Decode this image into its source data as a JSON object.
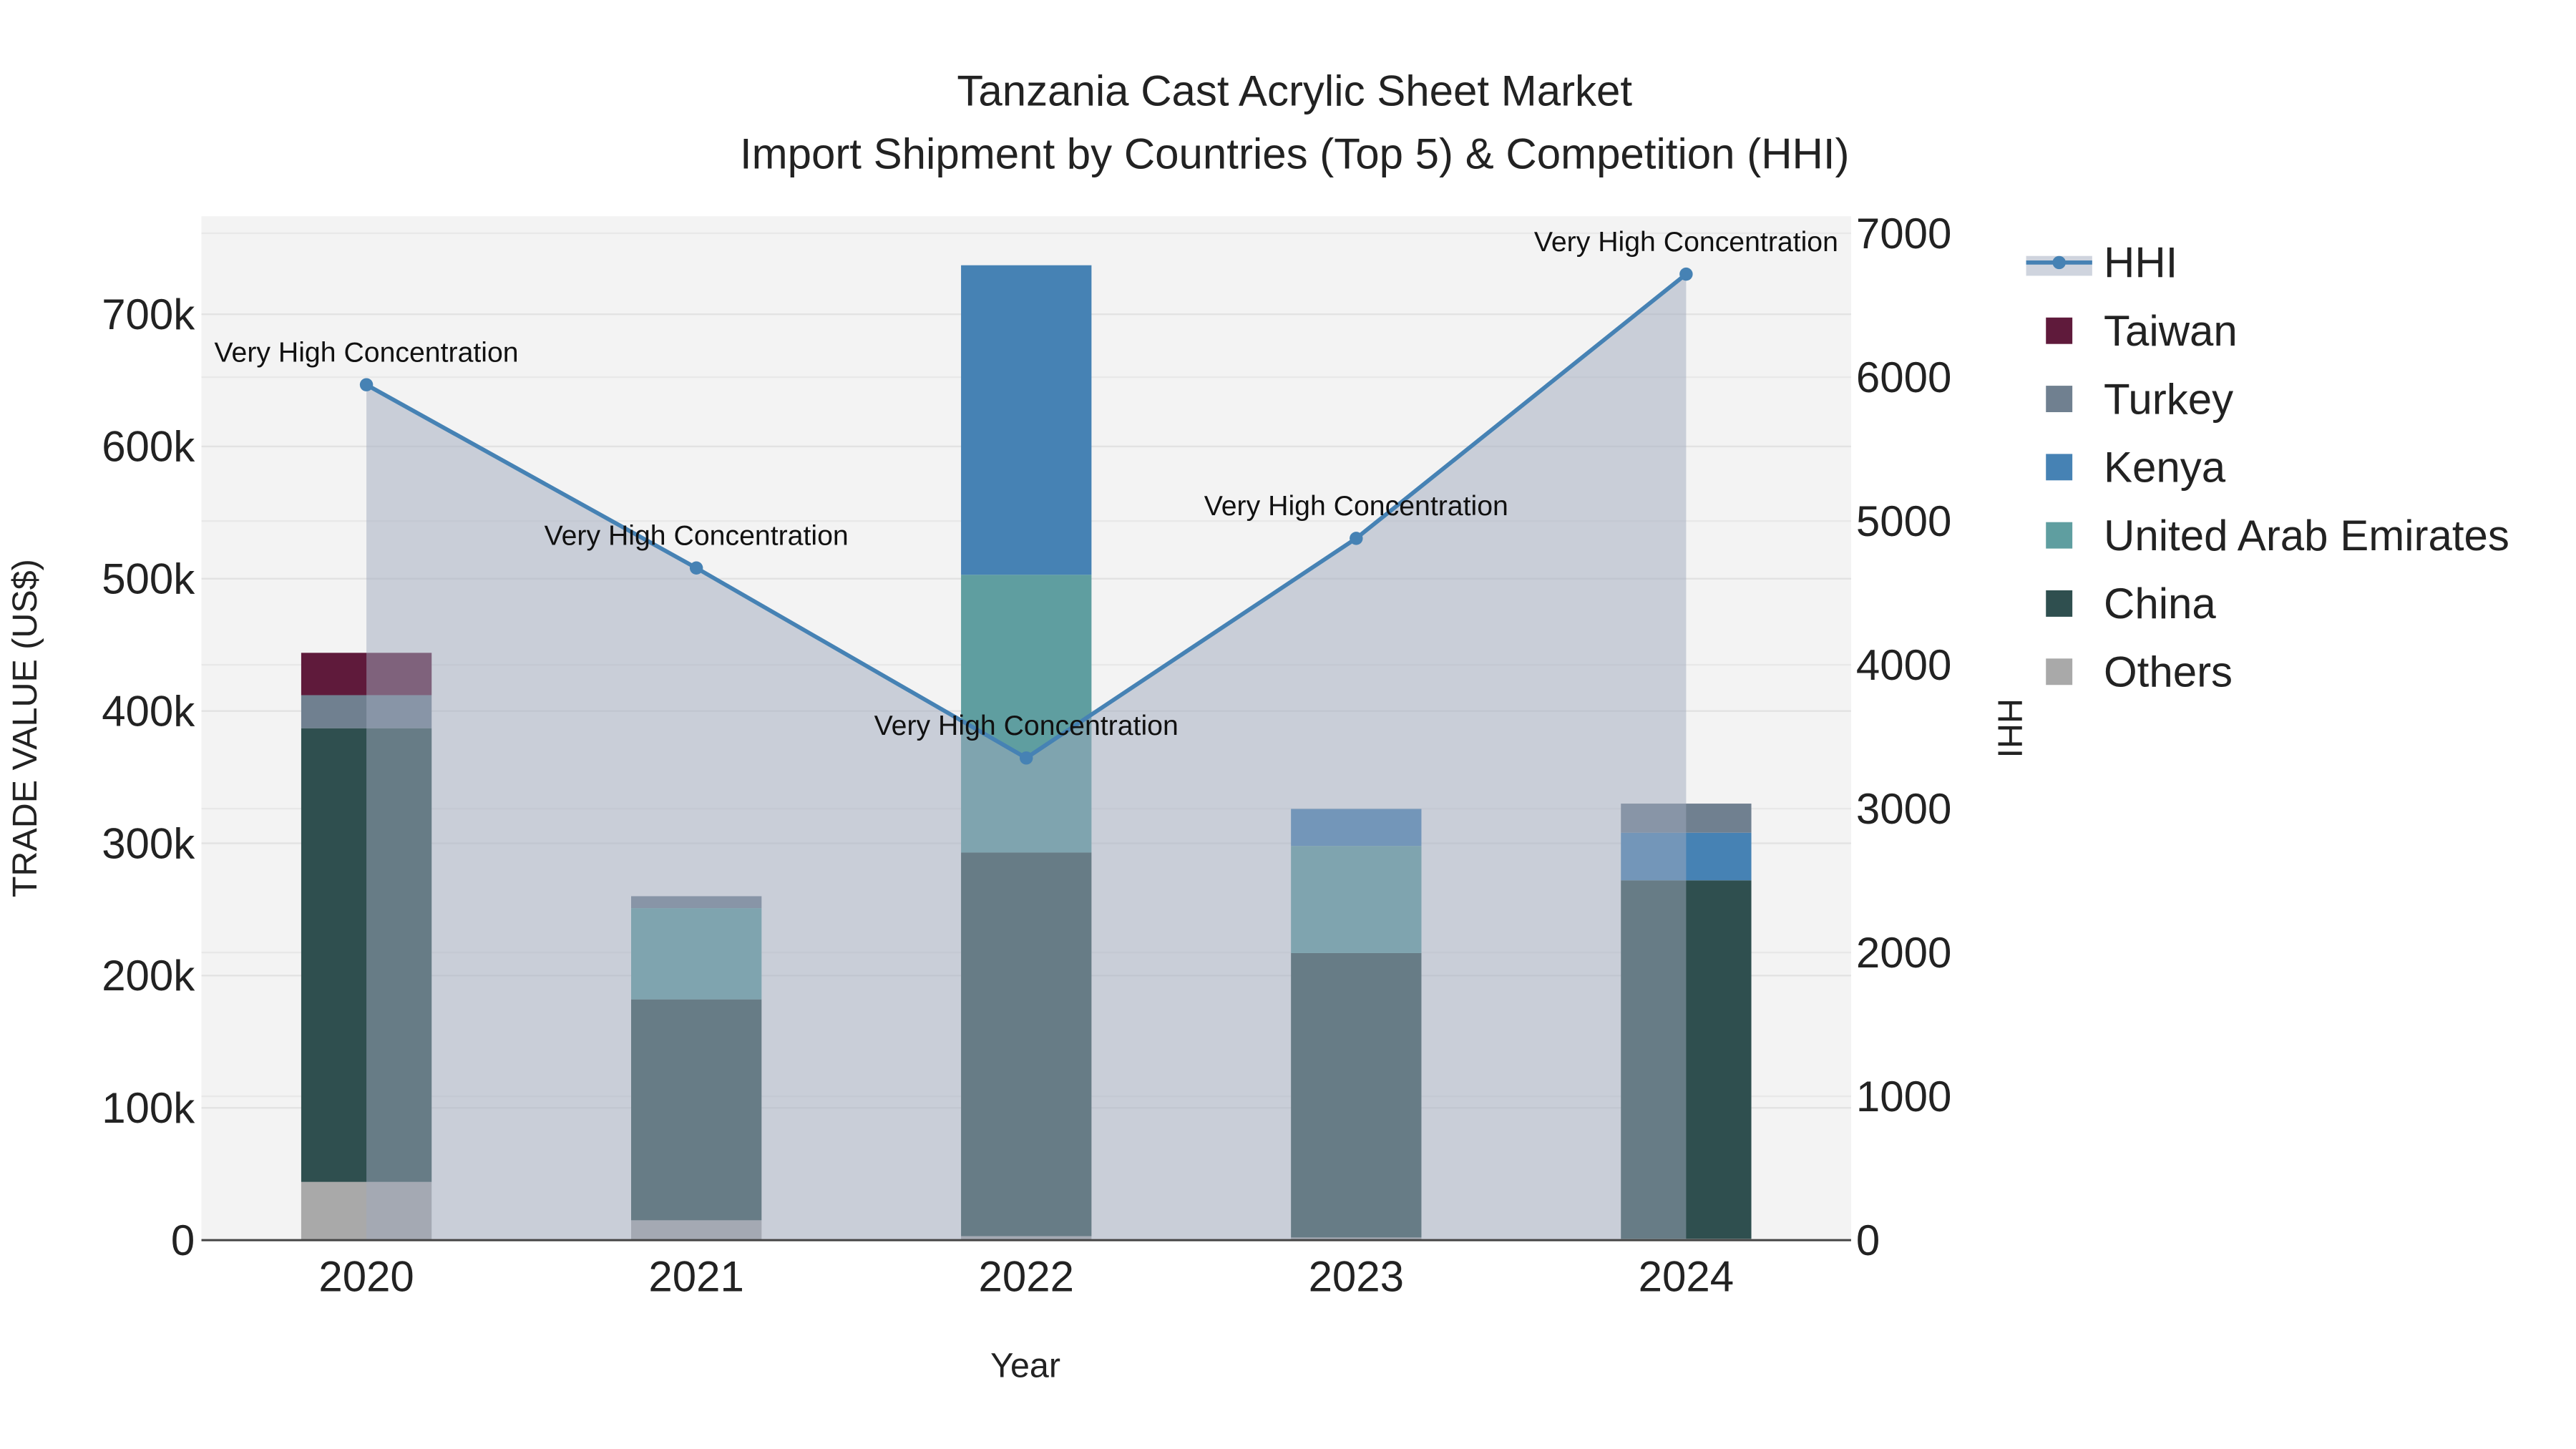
{
  "chart_data": {
    "type": "bar",
    "barmode": "stack",
    "title": "Tanzania Cast Acrylic Sheet Market",
    "subtitle": "Import Shipment by Countries (Top 5) & Competition (HHI)",
    "xlabel": "Year",
    "ylabel": "TRADE VALUE (US$)",
    "y2label": "HHI",
    "categories": [
      "2020",
      "2021",
      "2022",
      "2023",
      "2024"
    ],
    "ylim": [
      0,
      774000
    ],
    "y2lim": [
      0,
      7118
    ],
    "yticks": [
      0,
      100000,
      200000,
      300000,
      400000,
      500000,
      600000,
      700000
    ],
    "ytick_labels": [
      "0",
      "100k",
      "200k",
      "300k",
      "400k",
      "500k",
      "600k",
      "700k"
    ],
    "y2ticks": [
      0,
      1000,
      2000,
      3000,
      4000,
      5000,
      6000,
      7000
    ],
    "y2tick_labels": [
      "0",
      "1000",
      "2000",
      "3000",
      "4000",
      "5000",
      "6000",
      "7000"
    ],
    "grid": true,
    "legend_position": "right",
    "series": [
      {
        "name": "Others",
        "color": "#a9a9a9",
        "values": [
          44000,
          15000,
          3000,
          2000,
          1000
        ]
      },
      {
        "name": "China",
        "color": "#2f4f4f",
        "values": [
          343000,
          167000,
          290000,
          215000,
          271000
        ]
      },
      {
        "name": "United Arab Emirates",
        "color": "#5f9ea0",
        "values": [
          0,
          69000,
          210000,
          81000,
          0
        ]
      },
      {
        "name": "Kenya",
        "color": "#4682b4",
        "values": [
          0,
          0,
          234000,
          28000,
          36000
        ]
      },
      {
        "name": "Turkey",
        "color": "#708090",
        "values": [
          25000,
          9000,
          0,
          0,
          22000
        ]
      },
      {
        "name": "Taiwan",
        "color": "#5f1a3b",
        "values": [
          32000,
          0,
          0,
          0,
          0
        ]
      }
    ],
    "hhi": {
      "name": "HHI",
      "color": "#4682b4",
      "values": [
        5947,
        4673,
        3352,
        4879,
        6716
      ],
      "annotations": [
        "Very High Concentration",
        "Very High Concentration",
        "Very High Concentration",
        "Very High Concentration",
        "Very High Concentration"
      ]
    },
    "legend_order": [
      "HHI",
      "Taiwan",
      "Turkey",
      "Kenya",
      "United Arab Emirates",
      "China",
      "Others"
    ]
  }
}
